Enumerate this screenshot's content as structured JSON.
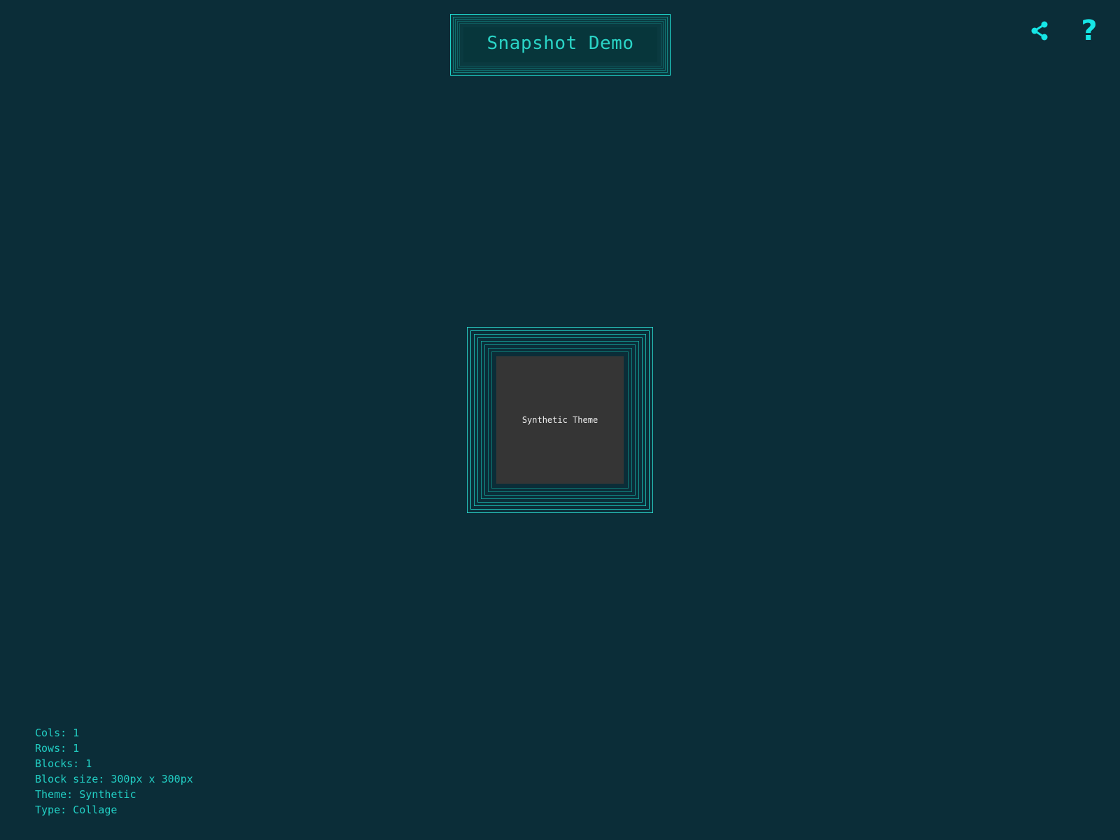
{
  "header": {
    "title": "Snapshot Demo"
  },
  "toolbar": {
    "share_icon": "share-icon",
    "help_icon": "help-icon",
    "help_glyph": "?"
  },
  "block": {
    "label": "Synthetic Theme"
  },
  "info": {
    "lines": [
      "Cols: 1",
      "Rows: 1",
      "Blocks: 1",
      "Block size: 300px x 300px",
      "Theme: Synthetic",
      "Type: Collage"
    ]
  },
  "colors": {
    "background": "#0b2d38",
    "accent": "#1fd6cc",
    "icon": "#16e6e6",
    "tile": "#353535"
  }
}
